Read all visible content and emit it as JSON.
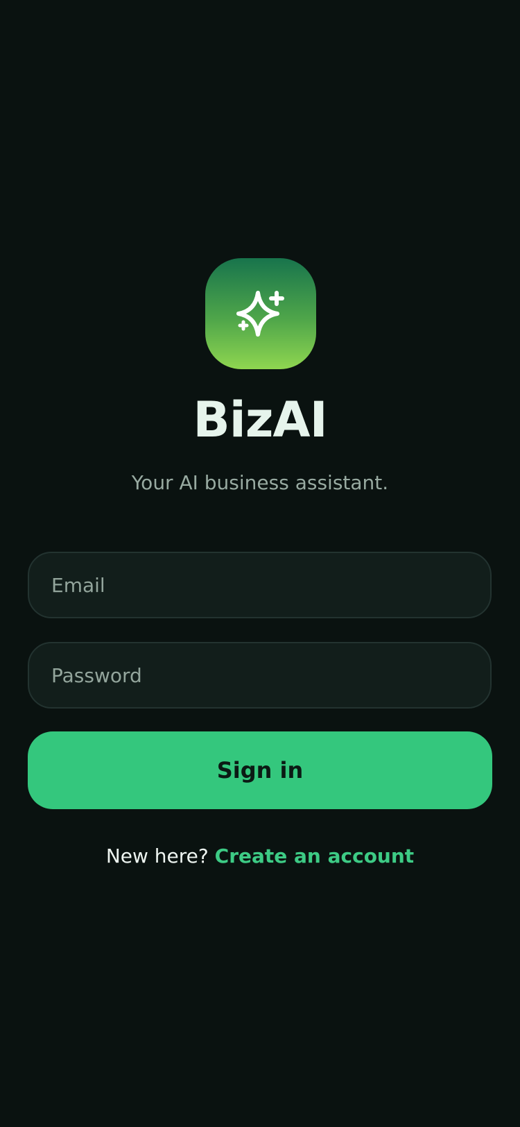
{
  "app": {
    "name": "BizAI",
    "tagline": "Your AI business assistant.",
    "logo_icon": "sparkle-icon"
  },
  "form": {
    "email_placeholder": "Email",
    "password_placeholder": "Password",
    "signin_label": "Sign in"
  },
  "signup": {
    "prompt": "New here?",
    "link_label": "Create an account"
  },
  "colors": {
    "background": "#0a1210",
    "accent": "#34c77d",
    "link": "#3dcb85",
    "logo_gradient_top": "#18744c",
    "logo_gradient_bottom": "#8fd650"
  }
}
